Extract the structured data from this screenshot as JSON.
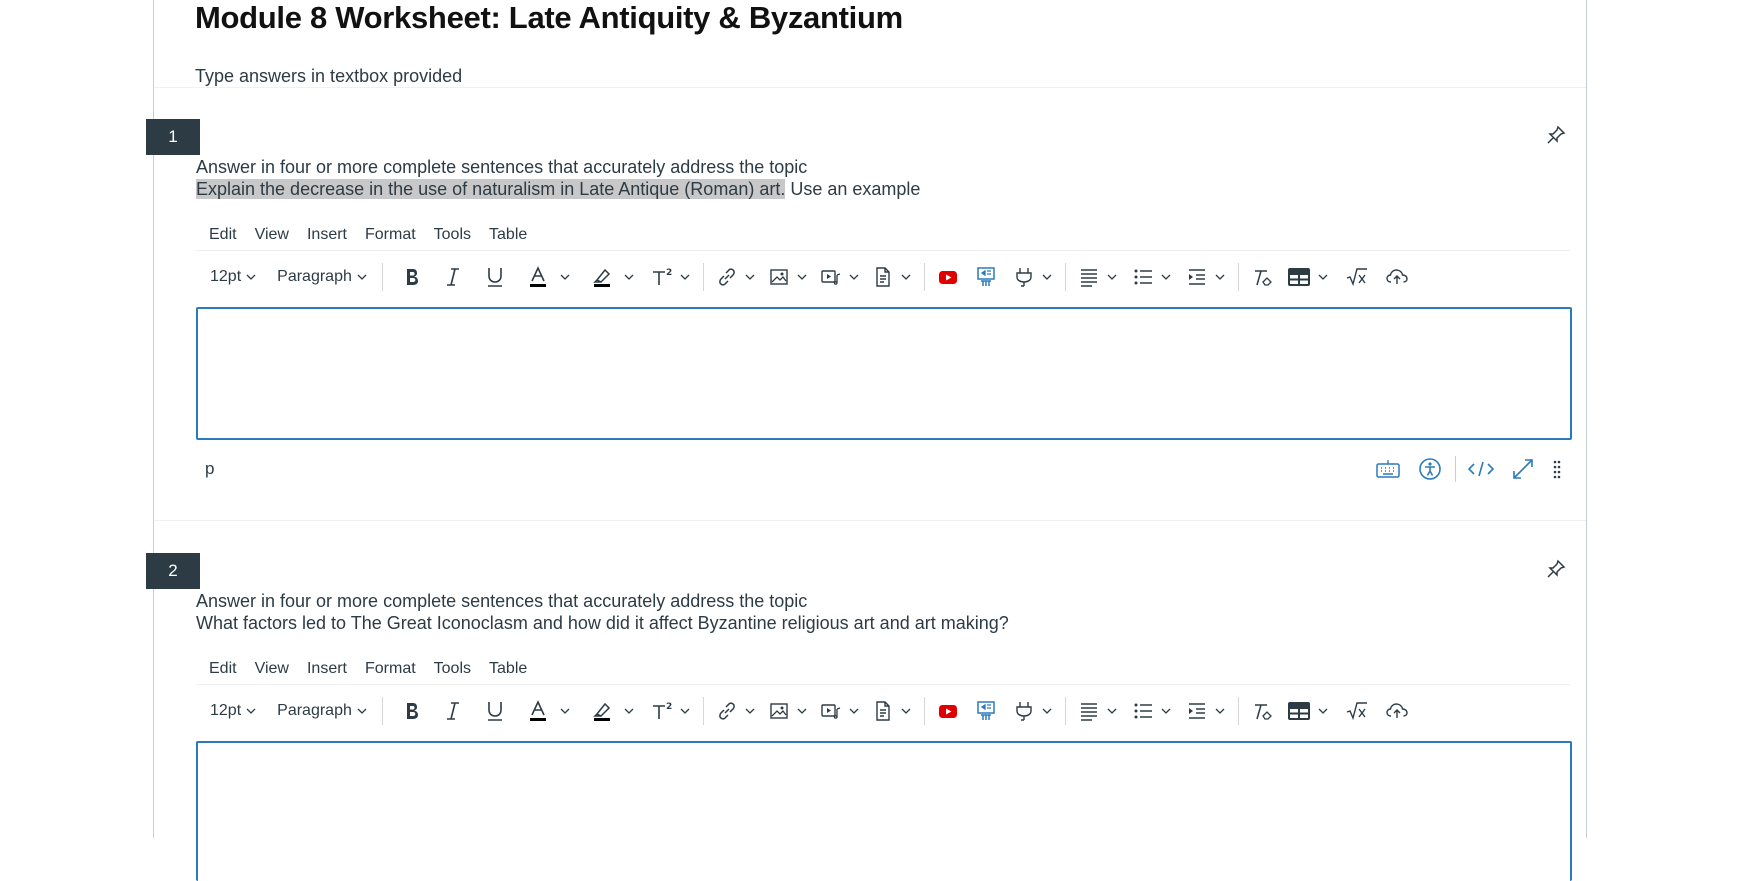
{
  "page": {
    "title": "Module 8 Worksheet: Late Antiquity & Byzantium",
    "instructions": "Type answers in textbox provided"
  },
  "editor": {
    "menu": [
      "Edit",
      "View",
      "Insert",
      "Format",
      "Tools",
      "Table"
    ],
    "font_size": "12pt",
    "block_format": "Paragraph",
    "status_path": "p",
    "accent_color": "#2b7abc",
    "youtube_color": "#e00000"
  },
  "questions": [
    {
      "number": "1",
      "prompt": "Answer in four or more complete sentences that accurately address the topic",
      "detail_highlighted": "Explain the decrease in the use of naturalism in Late Antique (Roman) art.",
      "detail_rest": " Use an example",
      "answer": ""
    },
    {
      "number": "2",
      "prompt": "Answer in four or more complete sentences that accurately address the topic",
      "detail_highlighted": "",
      "detail_rest": "What factors led to The Great Iconoclasm and how did it affect Byzantine religious art and art making?",
      "answer": ""
    }
  ]
}
